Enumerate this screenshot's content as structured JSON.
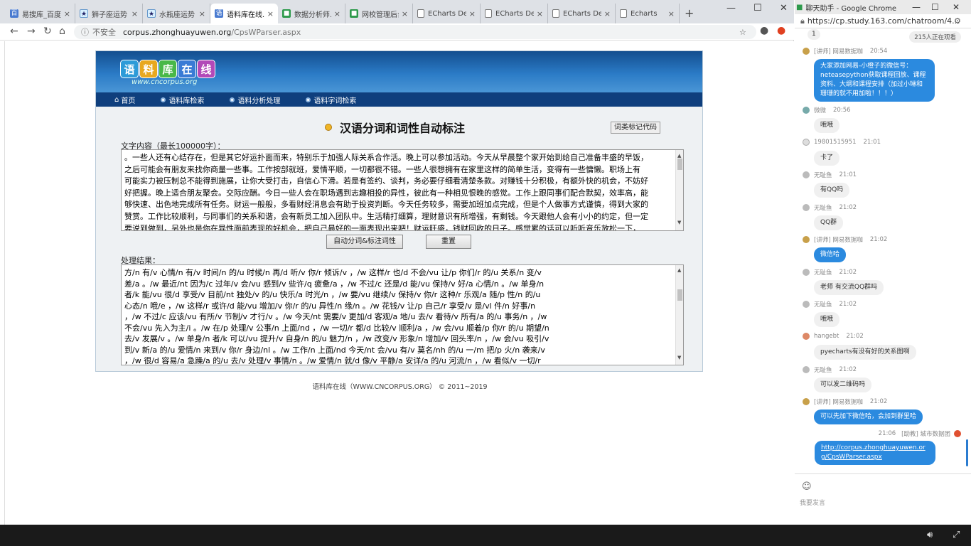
{
  "browser": {
    "tabs": [
      {
        "label": "易搜库_百度..."
      },
      {
        "label": "狮子座运势 ·..."
      },
      {
        "label": "水瓶座运势 ·..."
      },
      {
        "label": "语料库在线..."
      },
      {
        "label": "数据分析师..."
      },
      {
        "label": "网校管理后台..."
      },
      {
        "label": "ECharts Dem..."
      },
      {
        "label": "ECharts Dem..."
      },
      {
        "label": "ECharts Dem..."
      },
      {
        "label": "Echarts"
      }
    ],
    "address": {
      "security": "不安全",
      "domain": "corpus.zhonghuayuwen.org",
      "path": "/CpsWParser.aspx"
    }
  },
  "site": {
    "logo_chars": [
      "语",
      "料",
      "库",
      "在",
      "线"
    ],
    "logo_sub": "www.cncorpus.org",
    "nav": [
      {
        "label": "首页"
      },
      {
        "label": "语料库检索"
      },
      {
        "label": "语料分析处理"
      },
      {
        "label": "语料字词检索"
      }
    ],
    "title": "汉语分词和词性自动标注",
    "code_button": "词类标记代码",
    "input_label": "文字内容（最长100000字）：",
    "input_lines": [
      "。一些人还有心结存在，但是其它好运扑面而来，特别乐于加强人际关系合作活。晚上可以参加活动。今天从早晨整个家开始到给自己准备丰盛的早饭，",
      "之后可能会有朋友来找你商量一些事。工作按部就班，爱情平顺，一切都很不错。一些人很想拥有在家里这样的简单生活，变得有一些慵懒。职场上有",
      "可能实力被压制总不能得到施展，让你大受打击，自信心下滑。若是有签约、谈判，务必要仔细看清楚条款。对赚钱十分积极，有额外快的机会，不妨好",
      "好把握。晚上适合朋友聚会。交际应酬。今日一些人会在职场遇到志趣相投的异性，彼此有一种相见恨晚的感觉。工作上跟同事们配合默契，效率高，能",
      "够快速、出色地完成所有任务。财运一般般，多看财经消息会有助于投资判断。今天任务较多，需要加班加点完成，但是个人做事方式谨慎，得到大家的",
      "赞赏。工作比较顺利，与同事们的关系和谐，会有新员工加入团队中。生活精打细算，理财意识有所增强，有剩钱。今天跟他人会有小小的约定，但一定",
      "要说到做到，另外也是你在异性面前表现的好机会，把自己最好的一面表现出来吧！财运旺盛，钱财回收的日子。感觉累的话可以听听音乐放松一下，"
    ],
    "btn_segment": "自动分词&标注词性",
    "btn_reset": "重置",
    "result_label": "处理结果：",
    "result_lines": [
      "方/n  有/v  心情/n  有/v  时间/n  的/u  时候/n  再/d  听/v  你/r  倾诉/v  ，/w  这样/r  也/d  不会/vu  让/p  你们/r  的/u  关系/n  变/v",
      "差/a  。/w  最近/nt  因为/c  过年/v  会/vu  感到/v  些许/q  疲惫/a  ，/w  不过/c  还是/d  能/vu  保持/v  好/a  心情/n  。/w  单身/n",
      "者/k  能/vu  很/d  享受/v  目前/nt  独处/v  的/u  快乐/a  时光/n  ，/w  要/vu  继续/v  保持/v  你/r  这种/r  乐观/a  随/p  性/n  的/u",
      "心态/n  哦/e  ，/w  这样/r  或许/d  能/vu  增加/v  你/r  的/u  异性/n  缘/n  。/w  花钱/v  让/p  自己/r  享受/v  是/vl  件/n  好事/n",
      "，/w  不过/c  应该/vu  有所/v  节制/v  才行/v  。/w  今天/nt  需要/v  更加/d  客观/a  地/u  去/v  看待/v  所有/a  的/u  事务/n  ，/w",
      "不会/vu  先入为主/i  。/w  在/p  处理/v  公事/n  上面/nd  ，/w  一切/r  都/d  比较/v  顺利/a  ，/w  会/vu  顺着/p  你/r  的/u  期望/n",
      "去/v  发展/v  。/w  单身/n  者/k  可以/vu  提升/v  自身/n  的/u  魅力/n  ，/w  改变/v  形象/n  增加/v  回头率/n  ，/w  会/vu  吸引/v",
      "到/v  新/a  的/u  爱情/n  来到/v  你/r  身边/nl  。/w  工作/n  上面/nd  今天/nt  会/vu  有/v  莫名/nh  的/u  一/m  把/p  火/n  袭来/v",
      "，/w  很/d  容易/a  急躁/a  的/u  去/v  处理/v  事情/n  。/w  爱情/n  就/d  像/v  平静/a  安详/a  的/u  河流/n  ，/w  看似/v  一切/r"
    ],
    "footer": "语料库在线（WWW.CNCORPUS.ORG） ©   2011~2019"
  },
  "chat": {
    "window_title": "聊天助手 - Google Chrome",
    "url": "https://cp.study.163.com/chatroom/4...",
    "online_badge": "215人正在观看",
    "first_msg": "1",
    "messages": [
      {
        "name": "[讲师] 网易数据咖",
        "time": "20:54",
        "text": "大家添加网易-小橙子的微信号：neteasepython获取课程回放、课程资料、大纲和课程安排（加过小琳和珊珊的就不用加啦！！！）"
      },
      {
        "name": "微微",
        "time": "20:56",
        "text": "哦哦"
      },
      {
        "name": "19801515951",
        "time": "21:01",
        "text": "卡了"
      },
      {
        "name": "无耻鱼",
        "time": "21:01",
        "text": "有QQ吗"
      },
      {
        "name": "无耻鱼",
        "time": "21:02",
        "text": "QQ群"
      },
      {
        "name": "[讲师] 网易数据咖",
        "time": "21:02",
        "text": "微信哈"
      },
      {
        "name": "无耻鱼",
        "time": "21:02",
        "text": "老师 有交流QQ群吗"
      },
      {
        "name": "无耻鱼",
        "time": "21:02",
        "text": "哦哦"
      },
      {
        "name": "hangebt",
        "time": "21:02",
        "text": "pyecharts有没有好的关系图啊"
      },
      {
        "name": "无耻鱼",
        "time": "21:02",
        "text": "可以发二维码吗"
      },
      {
        "name": "[讲师] 网易数据咖",
        "time": "21:02",
        "text": "可以先加下微信哈，会加到群里哈"
      },
      {
        "name": "[助教] 城市数据团",
        "time": "21:06",
        "text": "http://corpus.zhonghuayuwen.org/CpsWParser.aspx"
      }
    ],
    "input_placeholder": "我要发言"
  }
}
